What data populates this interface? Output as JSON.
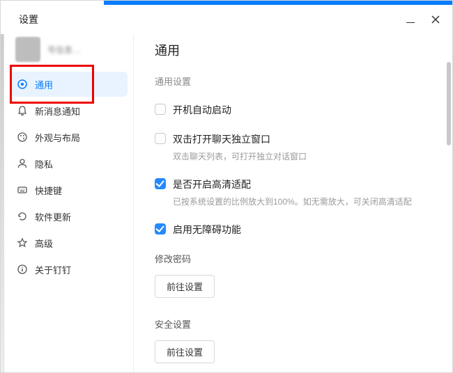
{
  "header": {
    "title": "设置"
  },
  "profile": {
    "text": "号信息…"
  },
  "sidebar": {
    "items": [
      {
        "label": "通用"
      },
      {
        "label": "新消息通知"
      },
      {
        "label": "外观与布局"
      },
      {
        "label": "隐私"
      },
      {
        "label": "快捷键"
      },
      {
        "label": "软件更新"
      },
      {
        "label": "高级"
      },
      {
        "label": "关于钉钉"
      }
    ]
  },
  "content": {
    "title": "通用",
    "section": "通用设置",
    "options": [
      {
        "label": "开机自动启动",
        "desc": "",
        "checked": false
      },
      {
        "label": "双击打开聊天独立窗口",
        "desc": "双击聊天列表，可打开独立对话窗口",
        "checked": false
      },
      {
        "label": "是否开启高清适配",
        "desc": "已按系统设置的比例放大到100%。如无需放大，可关闭高清适配",
        "checked": true
      },
      {
        "label": "启用无障碍功能",
        "desc": "",
        "checked": true
      }
    ],
    "groups": [
      {
        "label": "修改密码",
        "button": "前往设置"
      },
      {
        "label": "安全设置",
        "button": "前往设置"
      }
    ]
  }
}
